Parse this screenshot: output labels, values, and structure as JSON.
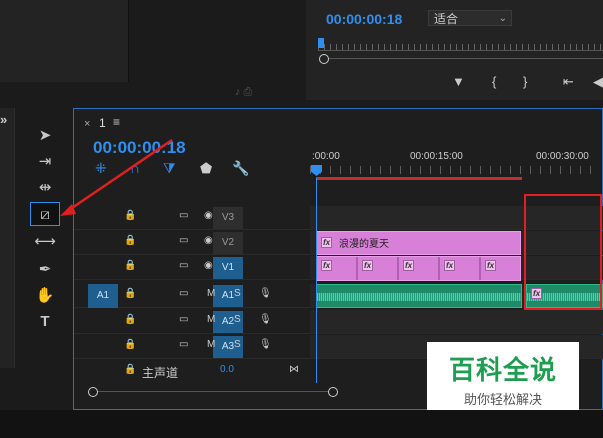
{
  "program_monitor": {
    "timecode": "00:00:00:18",
    "fit_value": "适合",
    "controls": [
      "▼",
      "{",
      "}",
      "⇤",
      "◀"
    ]
  },
  "timeline": {
    "close_symbol": "×",
    "sequence_name": "1",
    "menu_symbol": "≡",
    "timecode": "00:00:00:18",
    "ruler_labels": [
      ":00:00",
      "00:00:15:00",
      "00:00:30:00"
    ],
    "tracks": [
      {
        "name": "V3",
        "source": "",
        "controls": [
          "lock",
          "film",
          "eye"
        ]
      },
      {
        "name": "V2",
        "source": "",
        "controls": [
          "lock",
          "film",
          "eye"
        ]
      },
      {
        "name": "V1",
        "source": "",
        "controls": [
          "lock",
          "film",
          "eye"
        ]
      },
      {
        "name": "A1",
        "source": "A1",
        "m": "M",
        "s": "S"
      },
      {
        "name": "A2",
        "source": "",
        "m": "M",
        "s": "S"
      },
      {
        "name": "A3",
        "source": "",
        "m": "M",
        "s": "S"
      }
    ],
    "v2_clip_title": "浪漫的夏天",
    "fx_label": "fx",
    "master": {
      "label": "主声道",
      "value": "0.0"
    }
  },
  "watermark": {
    "title": "百科全说",
    "subtitle": "助你轻松解决"
  },
  "left_chevron": "»",
  "colors": {
    "accent": "#2f8ff0",
    "highlight": "#e02020",
    "pink_clip": "#d87fd8",
    "audio_clip": "#1e8a68"
  }
}
